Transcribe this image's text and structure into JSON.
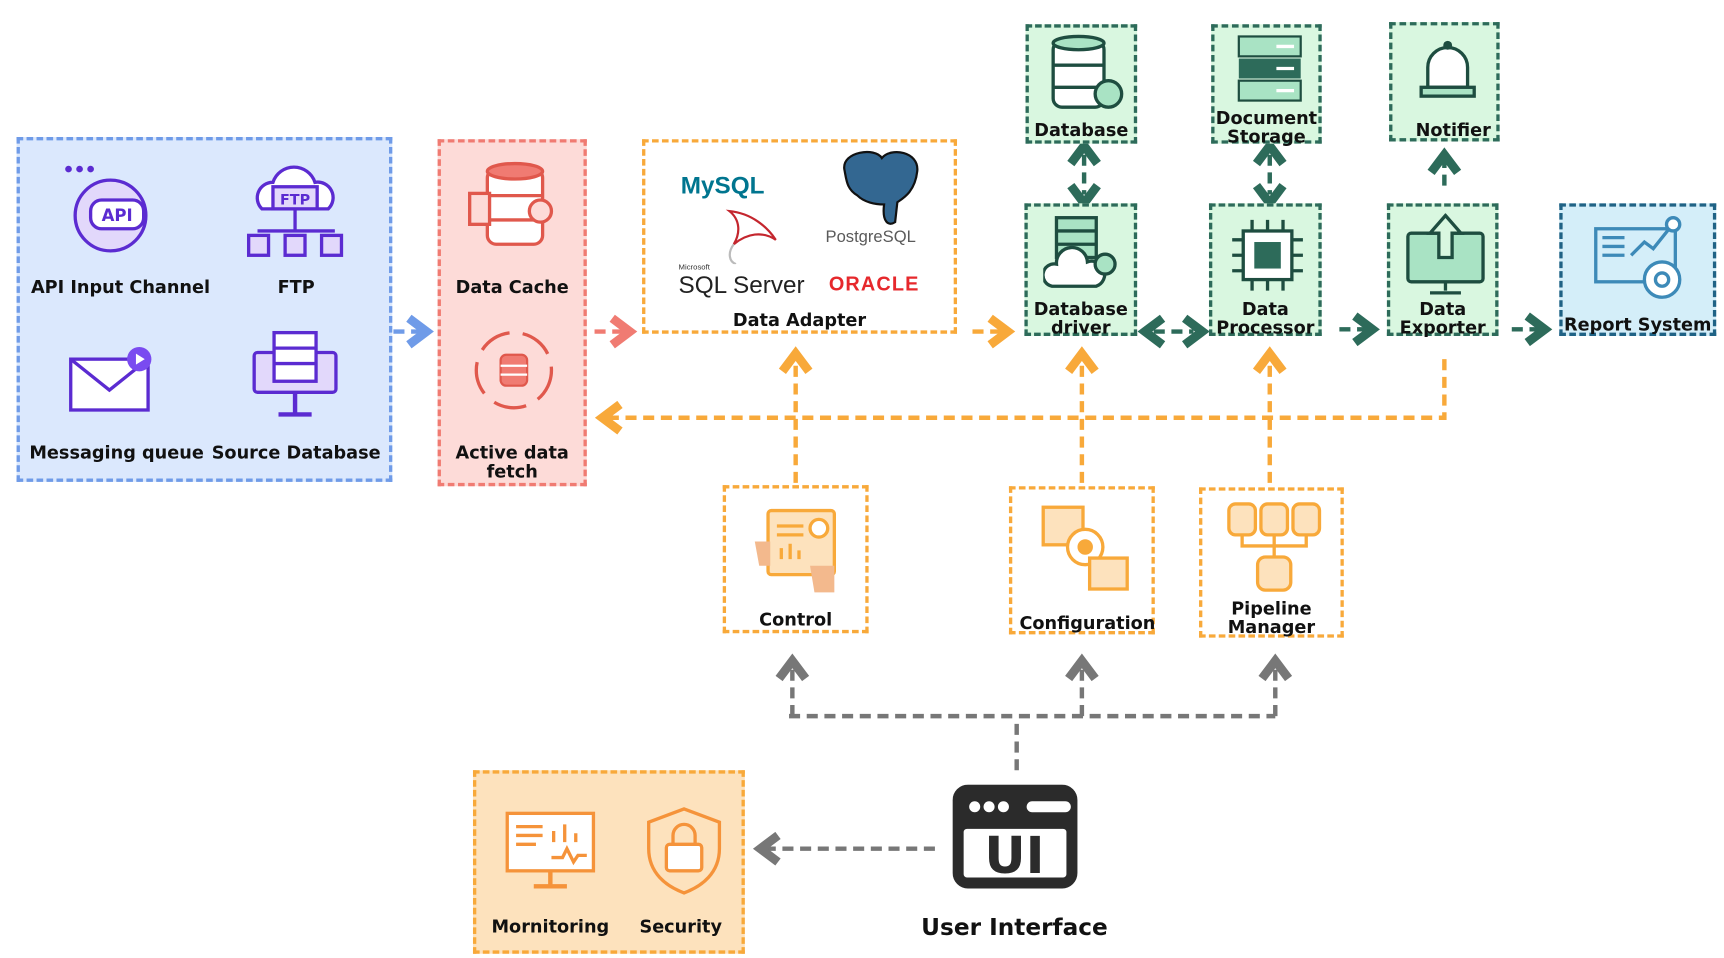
{
  "sources": {
    "items": [
      {
        "label": "API Input Channel",
        "icon": "api-icon"
      },
      {
        "label": "FTP",
        "icon": "ftp-icon"
      },
      {
        "label": "Messaging queue",
        "icon": "mail-icon"
      },
      {
        "label": "Source Database",
        "icon": "server-monitor-icon"
      }
    ]
  },
  "cache": {
    "items": [
      {
        "label": "Data Cache",
        "icon": "database-gear-icon"
      },
      {
        "label": "Active data fetch",
        "icon": "database-sync-icon"
      }
    ]
  },
  "adapter": {
    "label": "Data Adapter",
    "logos": {
      "mysql": "MySQL",
      "postgres": "PostgreSQL",
      "mssql_small": "Microsoft",
      "mssql": "SQL Server",
      "oracle": "ORACLE"
    }
  },
  "storage": {
    "database": "Database",
    "document_storage": "Document Storage",
    "notifier": "Notifier"
  },
  "pipeline": {
    "database_driver": "Database driver",
    "data_processor": "Data Processor",
    "data_exporter": "Data Exporter",
    "report_system": "Report System"
  },
  "controls": {
    "control": "Control",
    "configuration": "Configuration",
    "pipeline_manager": "Pipeline Manager"
  },
  "ops": {
    "monitoring": "Mornitoring",
    "security": "Security"
  },
  "ui": {
    "label": "User Interface",
    "icon_text": "UI"
  },
  "colors": {
    "blue": "#6f9be8",
    "red": "#f07b72",
    "orange": "#f8a93a",
    "green": "#2d6b5a",
    "teal": "#1f6285",
    "gray": "#777777"
  }
}
